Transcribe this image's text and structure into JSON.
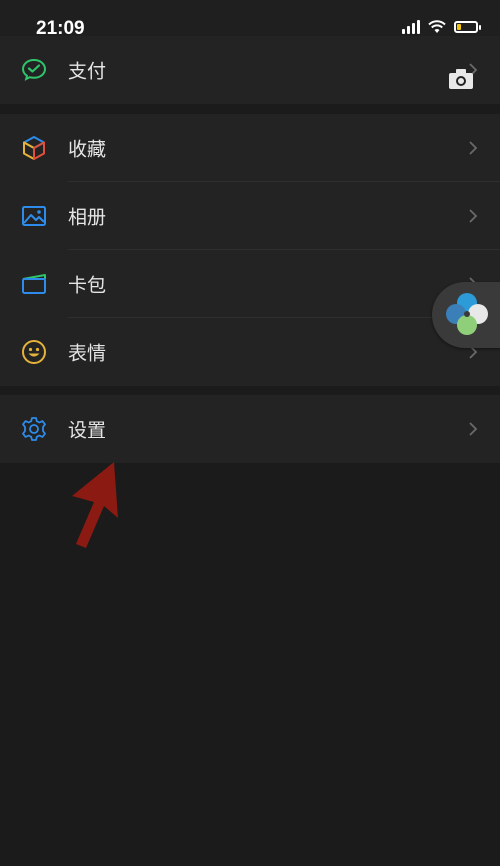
{
  "status_bar": {
    "time": "21:09",
    "battery_level": 0.2
  },
  "menu": {
    "pay": {
      "label": "支付",
      "icon": "wechat-pay-icon"
    },
    "favorites": {
      "label": "收藏",
      "icon": "cube-icon"
    },
    "album": {
      "label": "相册",
      "icon": "image-icon"
    },
    "cards": {
      "label": "卡包",
      "icon": "wallet-icon"
    },
    "stickers": {
      "label": "表情",
      "icon": "smiley-icon"
    },
    "settings": {
      "label": "设置",
      "icon": "gear-icon"
    }
  },
  "colors": {
    "background": "#1b1b1b",
    "group_background": "#232323",
    "accent_green": "#2fc56a",
    "accent_blue": "#2d8ceb",
    "accent_yellow": "#e6b33a",
    "annotation_arrow": "#8b1a12"
  }
}
